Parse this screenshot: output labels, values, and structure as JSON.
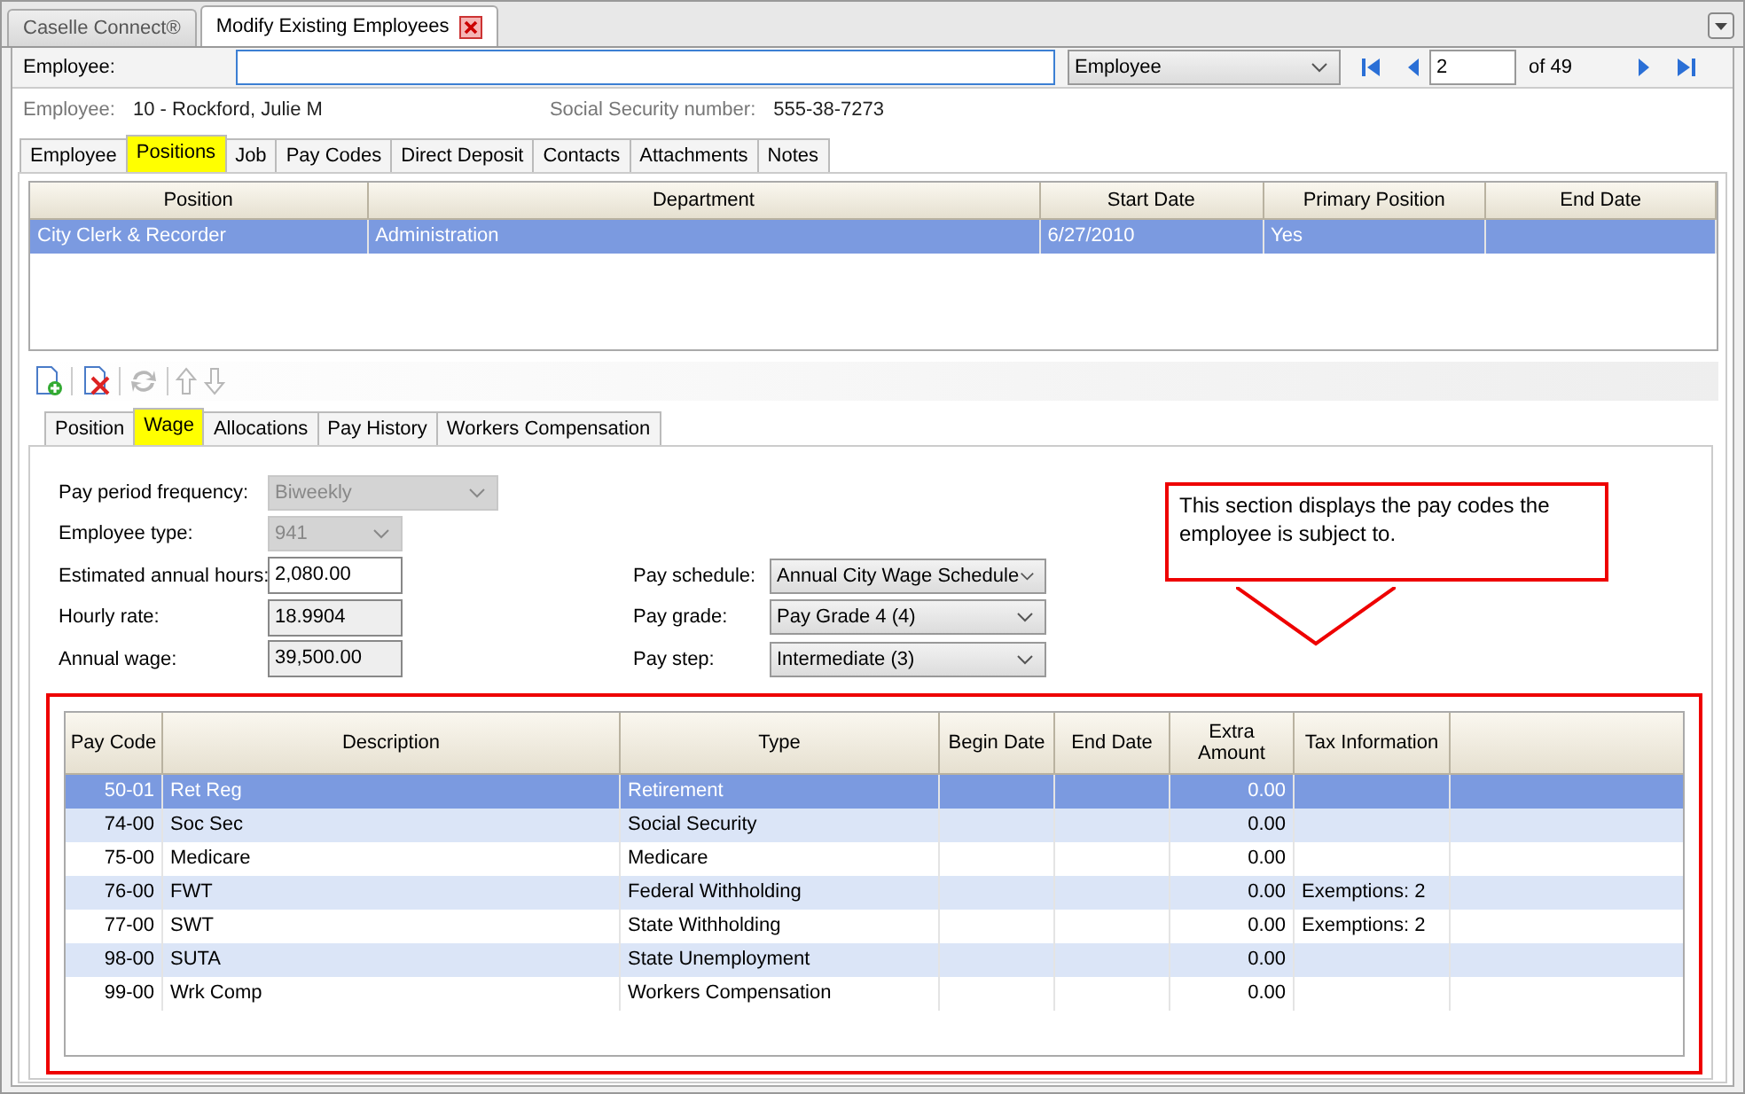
{
  "window_tabs": [
    {
      "label": "Caselle Connect®",
      "selected": false,
      "closable": false
    },
    {
      "label": "Modify Existing Employees",
      "selected": true,
      "closable": true
    }
  ],
  "employee_search": {
    "label": "Employee:",
    "lookup_by": "Employee",
    "record": "2",
    "record_count": "of 49"
  },
  "employee_info": {
    "label": "Employee:",
    "value": "10 - Rockford, Julie M",
    "ssn_label": "Social Security number:",
    "ssn": "555-38-7273"
  },
  "tabs": [
    {
      "label": "Employee",
      "selected": false
    },
    {
      "label": "Positions",
      "selected": true
    },
    {
      "label": "Job",
      "selected": false
    },
    {
      "label": "Pay Codes",
      "selected": false
    },
    {
      "label": "Direct Deposit",
      "selected": false
    },
    {
      "label": "Contacts",
      "selected": false
    },
    {
      "label": "Attachments",
      "selected": false
    },
    {
      "label": "Notes",
      "selected": false
    }
  ],
  "positions": {
    "columns": [
      "Position",
      "Department",
      "Start Date",
      "Primary Position",
      "End Date"
    ],
    "rows": [
      {
        "cells": [
          "City Clerk & Recorder",
          "Administration",
          "6/27/2010",
          "Yes",
          ""
        ],
        "selected": true
      }
    ]
  },
  "toolbar": [
    {
      "kind": "add",
      "disabled": false
    },
    {
      "kind": "delete",
      "disabled": false
    },
    {
      "kind": "refresh",
      "disabled": true
    },
    {
      "kind": "up",
      "disabled": true
    },
    {
      "kind": "down",
      "disabled": true
    }
  ],
  "sub_tabs": [
    {
      "label": "Position",
      "selected": false
    },
    {
      "label": "Wage",
      "selected": true
    },
    {
      "label": "Allocations",
      "selected": false
    },
    {
      "label": "Pay History",
      "selected": false
    },
    {
      "label": "Workers Compensation",
      "selected": false
    }
  ],
  "wage_form": {
    "left": [
      {
        "label": "Pay period frequency:",
        "value": "Biweekly",
        "kind": "dropdown",
        "disabled": true
      },
      {
        "label": "Employee type:",
        "value": "941",
        "kind": "dropdown",
        "disabled": true
      },
      {
        "label": "Estimated annual hours:",
        "value": "2,080.00",
        "kind": "text",
        "disabled": false
      },
      {
        "label": "Hourly rate:",
        "value": "18.9904",
        "kind": "text",
        "disabled": true
      },
      {
        "label": "Annual wage:",
        "value": "39,500.00",
        "kind": "text",
        "disabled": true
      }
    ],
    "right": [
      {
        "label": "Pay schedule:",
        "value": "Annual City Wage Schedule",
        "kind": "dropdown",
        "disabled": false
      },
      {
        "label": "Pay grade:",
        "value": "Pay Grade 4 (4)",
        "kind": "dropdown",
        "disabled": false
      },
      {
        "label": "Pay step:",
        "value": "Intermediate (3)",
        "kind": "dropdown",
        "disabled": false
      }
    ]
  },
  "callout": {
    "text": "This section displays the pay codes the employee is subject to."
  },
  "pay_codes": {
    "columns": [
      "Pay Code",
      "Description",
      "Type",
      "Begin Date",
      "End Date",
      "Extra Amount",
      "Tax Information"
    ],
    "rows": [
      {
        "cells": [
          "50-01",
          "Ret Reg",
          "Retirement",
          "",
          "",
          "0.00",
          ""
        ],
        "selected": true
      },
      {
        "cells": [
          "74-00",
          "Soc Sec",
          "Social Security",
          "",
          "",
          "0.00",
          ""
        ],
        "selected": false
      },
      {
        "cells": [
          "75-00",
          "Medicare",
          "Medicare",
          "",
          "",
          "0.00",
          ""
        ],
        "selected": false
      },
      {
        "cells": [
          "76-00",
          "FWT",
          "Federal Withholding",
          "",
          "",
          "0.00",
          "Exemptions: 2"
        ],
        "selected": false
      },
      {
        "cells": [
          "77-00",
          "SWT",
          "State Withholding",
          "",
          "",
          "0.00",
          "Exemptions: 2"
        ],
        "selected": false
      },
      {
        "cells": [
          "98-00",
          "SUTA",
          "State Unemployment",
          "",
          "",
          "0.00",
          ""
        ],
        "selected": false
      },
      {
        "cells": [
          "99-00",
          "Wrk Comp",
          "Workers Compensation",
          "",
          "",
          "0.00",
          ""
        ],
        "selected": false
      }
    ]
  }
}
